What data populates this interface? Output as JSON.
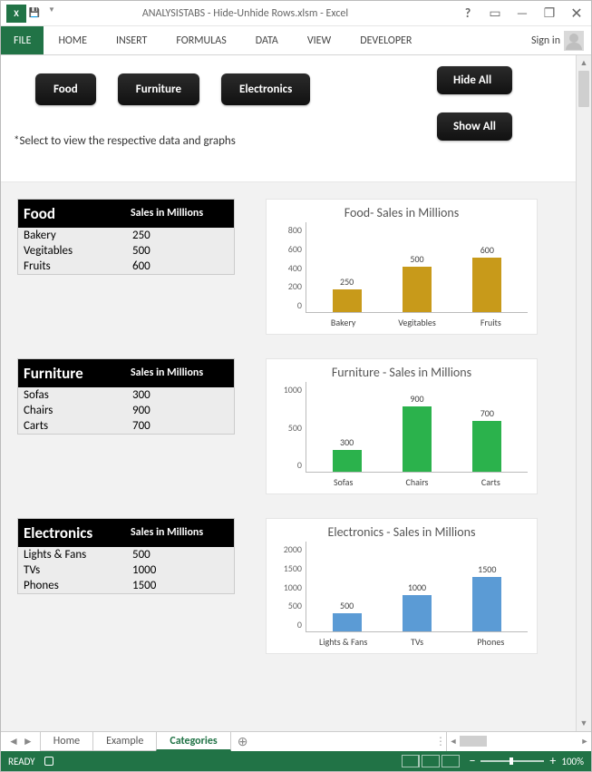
{
  "app": {
    "title": "ANALYSISTABS - Hide-Unhide Rows.xlsm - Excel",
    "signin": "Sign in"
  },
  "ribbon": {
    "file": "FILE",
    "tabs": [
      "HOME",
      "INSERT",
      "FORMULAS",
      "DATA",
      "VIEW",
      "DEVELOPER"
    ]
  },
  "buttons": {
    "food": "Food",
    "furniture": "Furniture",
    "electronics": "Electronics",
    "hide_all": "Hide All",
    "show_all": "Show All"
  },
  "note": "*Select to view the respective data and graphs",
  "tables": {
    "header2": "Sales in Millions",
    "food": {
      "name": "Food",
      "rows": [
        [
          "Bakery",
          "250"
        ],
        [
          "Vegitables",
          "500"
        ],
        [
          "Fruits",
          "600"
        ]
      ]
    },
    "furniture": {
      "name": "Furniture",
      "rows": [
        [
          "Sofas",
          "300"
        ],
        [
          "Chairs",
          "900"
        ],
        [
          "Carts",
          "700"
        ]
      ]
    },
    "electronics": {
      "name": "Electronics",
      "rows": [
        [
          "Lights & Fans",
          "500"
        ],
        [
          "TVs",
          "1000"
        ],
        [
          "Phones",
          "1500"
        ]
      ]
    }
  },
  "chart_data": [
    {
      "type": "bar",
      "title": "Food- Sales in Millions",
      "categories": [
        "Bakery",
        "Vegitables",
        "Fruits"
      ],
      "values": [
        250,
        500,
        600
      ],
      "yticks": [
        800,
        600,
        400,
        200,
        0
      ],
      "ymax": 800,
      "color": "gold"
    },
    {
      "type": "bar",
      "title": "Furniture - Sales in Millions",
      "categories": [
        "Sofas",
        "Chairs",
        "Carts"
      ],
      "values": [
        300,
        900,
        700
      ],
      "yticks": [
        1000,
        500,
        0
      ],
      "ymax": 1000,
      "color": "green"
    },
    {
      "type": "bar",
      "title": "Electronics - Sales in Millions",
      "categories": [
        "Lights & Fans",
        "TVs",
        "Phones"
      ],
      "values": [
        500,
        1000,
        1500
      ],
      "yticks": [
        2000,
        1500,
        1000,
        500,
        0
      ],
      "ymax": 2000,
      "color": "blue"
    }
  ],
  "sheets": {
    "items": [
      "Home",
      "Example",
      "Categories"
    ],
    "active": "Categories"
  },
  "status": {
    "ready": "READY",
    "zoom": "100%"
  }
}
